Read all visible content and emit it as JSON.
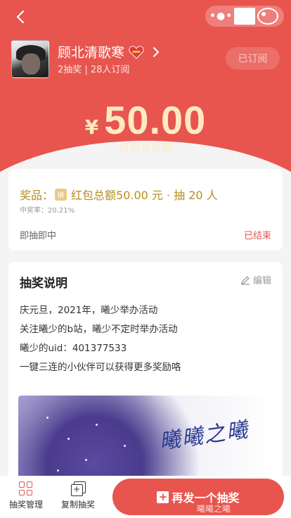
{
  "header": {
    "back_icon": "chevron-left-icon",
    "capsule_icons": [
      "more-dots-icon",
      "minimize-icon",
      "close-target-icon"
    ]
  },
  "profile": {
    "username": "顾北清歌寒",
    "stats": "2抽奖 | 28人订阅",
    "subscribe_label": "已订阅"
  },
  "amount": {
    "currency": "¥",
    "value": "50.00",
    "label": "红包总金额"
  },
  "prize": {
    "prefix": "奖品：",
    "badge": "拼",
    "text": "红包总额50.00 元 · 抽 20 人",
    "win_rate": "中奖率：20.21%",
    "mode": "即抽即中",
    "status": "已结束"
  },
  "description": {
    "title": "抽奖说明",
    "edit_label": "编辑",
    "lines": [
      "庆元旦，2021年，曦少举办活动",
      "关注曦少的b站，曦少不定时举办活动",
      "曦少的uid：401377533",
      "一键三连的小伙伴可以获得更多奖励咯"
    ],
    "banner_text": "曦曦之曦"
  },
  "bottom": {
    "manage_label": "抽奖管理",
    "copy_label": "复制抽奖",
    "primary_label": "再发一个抽奖",
    "watermark": "曦曦之曦"
  },
  "colors": {
    "brand_red": "#e8554e",
    "amount_gold": "#fde9c3",
    "prize_gold": "#b78d1e"
  }
}
